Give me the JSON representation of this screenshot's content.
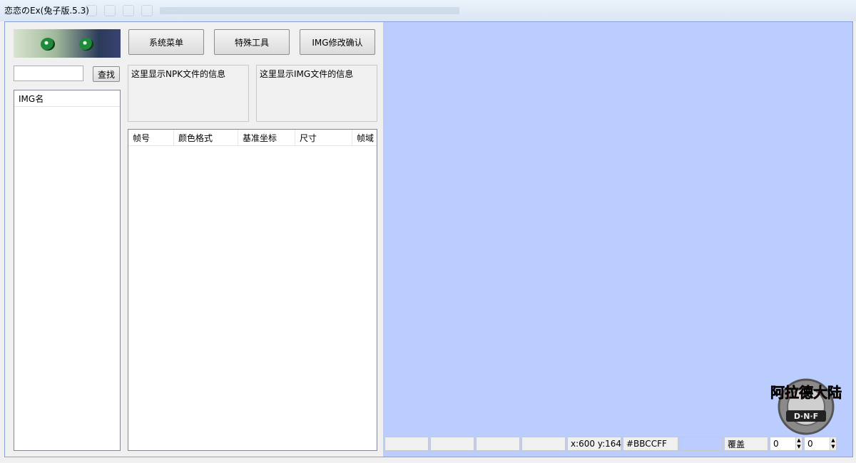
{
  "window": {
    "title": "恋恋のEx(兔子版.5.3)"
  },
  "toolbar": {
    "system_menu": "系统菜单",
    "special_tools": "特殊工具",
    "img_confirm": "IMG修改确认"
  },
  "search": {
    "button": "查找",
    "value": ""
  },
  "img_list": {
    "header": "IMG名"
  },
  "info": {
    "npk": "这里显示NPK文件的信息",
    "img": "这里显示IMG文件的信息"
  },
  "frame_table": {
    "columns": [
      "帧号",
      "颜色格式",
      "基准坐标",
      "尺寸",
      "帧域"
    ]
  },
  "canvas": {
    "background_color": "#bbccff"
  },
  "status": {
    "coords": "x:600 y:164",
    "color_hex": "#BBCCFF",
    "mode": "覆盖",
    "spin1": "0",
    "spin2": "0"
  },
  "logo": {
    "text": "阿拉德大陆",
    "sub": "D·N·F"
  }
}
